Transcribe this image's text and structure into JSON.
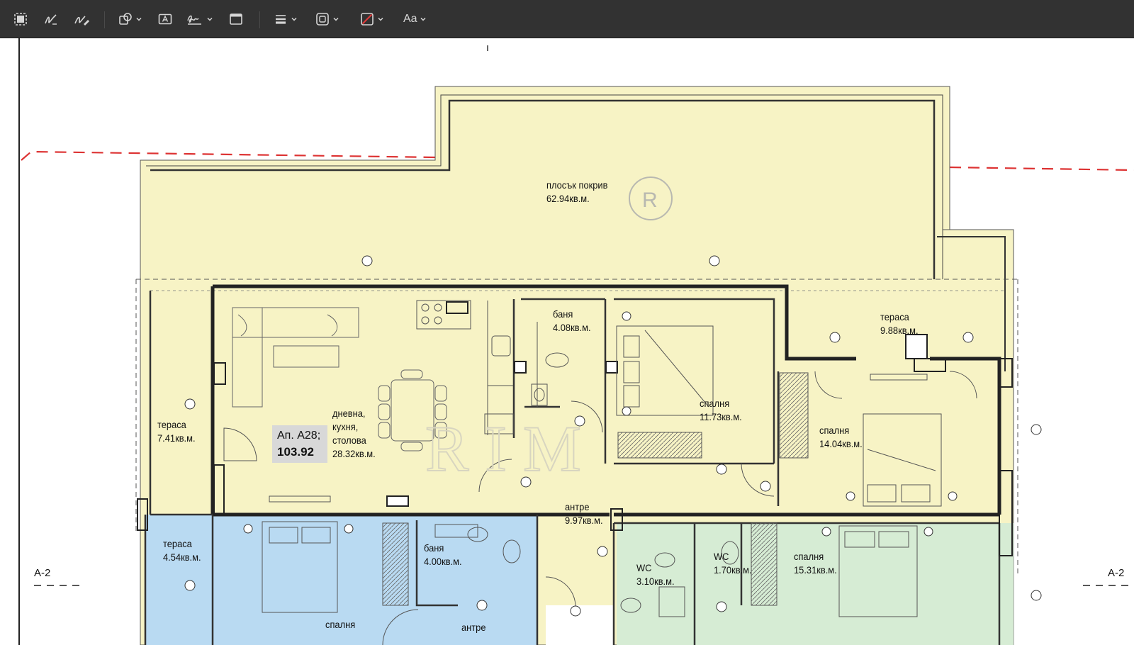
{
  "toolbar": {
    "tools": [
      {
        "name": "selection-icon"
      },
      {
        "name": "sketch-icon"
      },
      {
        "name": "draw-icon"
      },
      {
        "name": "shapes-icon"
      },
      {
        "name": "text-box-icon"
      },
      {
        "name": "signature-icon"
      },
      {
        "name": "note-icon"
      },
      {
        "name": "shape-style-icon"
      },
      {
        "name": "border-color-icon"
      },
      {
        "name": "fill-color-icon"
      }
    ],
    "font_label": "Aa"
  },
  "plan": {
    "apartment": {
      "code": "Ап. А28;",
      "area": "103.92"
    },
    "rooms": {
      "flat_roof": {
        "name": "плосък покрив",
        "area": "62.94кв.м."
      },
      "terrace_left": {
        "name": "тераса",
        "area": "7.41кв.м."
      },
      "living": {
        "name": "дневна,",
        "name2": "кухня,",
        "name3": "столова",
        "area": "28.32кв.м."
      },
      "bath_top": {
        "name": "баня",
        "area": "4.08кв.м."
      },
      "bedroom_mid": {
        "name": "спалня",
        "area": "11.73кв.м."
      },
      "terrace_right": {
        "name": "тераса",
        "area": "9.88кв.м."
      },
      "bedroom_right": {
        "name": "спалня",
        "area": "14.04кв.м."
      },
      "entrance": {
        "name": "антре",
        "area": "9.97кв.м."
      },
      "terrace_bottom_left": {
        "name": "тераса",
        "area": "4.54кв.м."
      },
      "bath_bottom": {
        "name": "баня",
        "area": "4.00кв.м."
      },
      "wc_1": {
        "name": "WC",
        "area": "3.10кв.м."
      },
      "wc_2": {
        "name": "WC",
        "area": "1.70кв.м."
      },
      "bedroom_bottom_right": {
        "name": "спалня",
        "area": "15.31кв.м."
      },
      "bedroom_bottom": {
        "name": "спалня"
      },
      "entrance_bottom": {
        "name": "антре"
      }
    },
    "section_marks": {
      "left": "A-2",
      "right": "A-2"
    }
  }
}
